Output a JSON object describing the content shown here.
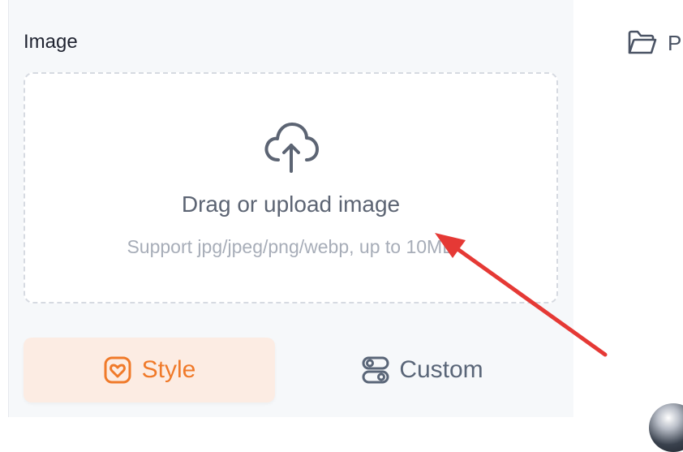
{
  "image_section": {
    "title": "Image",
    "upload": {
      "icon": "cloud-upload-icon",
      "main_text": "Drag or upload image",
      "sub_text": "Support jpg/jpeg/png/webp, up to 10MB"
    }
  },
  "tabs": [
    {
      "label": "Style",
      "icon": "heart-frame-icon",
      "active": true
    },
    {
      "label": "Custom",
      "icon": "toggle-settings-icon",
      "active": false
    }
  ],
  "right_panel": {
    "item_label": "P",
    "item_icon": "folder-open-icon"
  },
  "colors": {
    "accent": "#f07a2a",
    "accent_bg": "#fcece3",
    "annotation_arrow": "#e53935"
  }
}
